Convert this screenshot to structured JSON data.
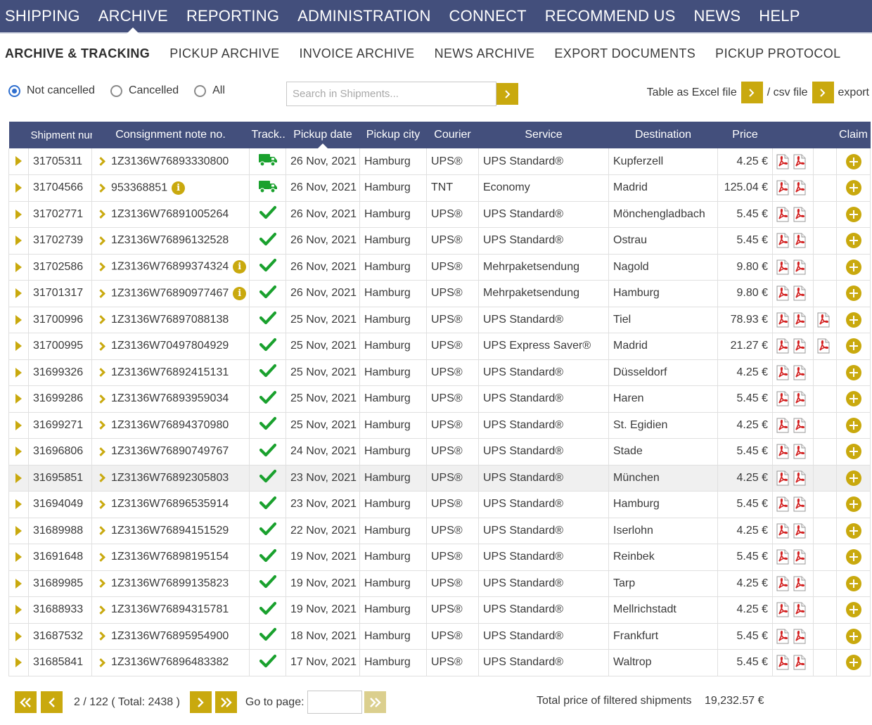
{
  "topnav": [
    {
      "label": "SHIPPING",
      "active": false
    },
    {
      "label": "ARCHIVE",
      "active": true
    },
    {
      "label": "REPORTING",
      "active": false
    },
    {
      "label": "ADMINISTRATION",
      "active": false
    },
    {
      "label": "CONNECT",
      "active": false
    },
    {
      "label": "RECOMMEND US",
      "active": false
    },
    {
      "label": "NEWS",
      "active": false
    },
    {
      "label": "HELP",
      "active": false
    }
  ],
  "subnav": [
    {
      "label": "ARCHIVE & TRACKING",
      "active": true
    },
    {
      "label": "PICKUP ARCHIVE",
      "active": false
    },
    {
      "label": "INVOICE ARCHIVE",
      "active": false
    },
    {
      "label": "NEWS ARCHIVE",
      "active": false
    },
    {
      "label": "EXPORT DOCUMENTS",
      "active": false
    },
    {
      "label": "PICKUP PROTOCOL",
      "active": false
    }
  ],
  "filters": {
    "options": [
      {
        "label": "Not cancelled",
        "checked": true
      },
      {
        "label": "Cancelled",
        "checked": false
      },
      {
        "label": "All",
        "checked": false
      }
    ],
    "search_placeholder": "Search in Shipments...",
    "search_value": "",
    "excel_label": "Table as Excel file",
    "csv_label": "/ csv file",
    "export_label": "export"
  },
  "table": {
    "headers": {
      "shipment_number": "Shipment number",
      "consignment": "Consignment note no.",
      "tracking": "Track..",
      "pickup_date": "Pickup date",
      "pickup_city": "Pickup city",
      "courier": "Courier",
      "service": "Service",
      "destination": "Destination",
      "price": "Price",
      "claim": "Claim"
    },
    "sorted_column": "pickup_date",
    "hover_row_index": 12,
    "rows": [
      {
        "id": "31705311",
        "consignment": "1Z3136W76893330800",
        "info": false,
        "status": "in-transit",
        "date": "26 Nov, 2021",
        "city": "Hamburg",
        "courier": "UPS®",
        "service": "UPS Standard®",
        "destination": "Kupferzell",
        "price": "4.25 €",
        "docs": 2,
        "extra_doc": false
      },
      {
        "id": "31704566",
        "consignment": "953368851",
        "info": true,
        "status": "in-transit",
        "date": "26 Nov, 2021",
        "city": "Hamburg",
        "courier": "TNT",
        "service": "Economy",
        "destination": "Madrid",
        "price": "125.04 €",
        "docs": 2,
        "extra_doc": false
      },
      {
        "id": "31702771",
        "consignment": "1Z3136W76891005264",
        "info": false,
        "status": "delivered",
        "date": "26 Nov, 2021",
        "city": "Hamburg",
        "courier": "UPS®",
        "service": "UPS Standard®",
        "destination": "Mönchengladbach",
        "price": "5.45 €",
        "docs": 2,
        "extra_doc": false
      },
      {
        "id": "31702739",
        "consignment": "1Z3136W76896132528",
        "info": false,
        "status": "delivered",
        "date": "26 Nov, 2021",
        "city": "Hamburg",
        "courier": "UPS®",
        "service": "UPS Standard®",
        "destination": "Ostrau",
        "price": "5.45 €",
        "docs": 2,
        "extra_doc": false
      },
      {
        "id": "31702586",
        "consignment": "1Z3136W76899374324",
        "info": true,
        "status": "delivered",
        "date": "26 Nov, 2021",
        "city": "Hamburg",
        "courier": "UPS®",
        "service": "Mehrpaketsendung",
        "destination": "Nagold",
        "price": "9.80 €",
        "docs": 2,
        "extra_doc": false
      },
      {
        "id": "31701317",
        "consignment": "1Z3136W76890977467",
        "info": true,
        "status": "delivered",
        "date": "26 Nov, 2021",
        "city": "Hamburg",
        "courier": "UPS®",
        "service": "Mehrpaketsendung",
        "destination": "Hamburg",
        "price": "9.80 €",
        "docs": 2,
        "extra_doc": false
      },
      {
        "id": "31700996",
        "consignment": "1Z3136W76897088138",
        "info": false,
        "status": "delivered",
        "date": "25 Nov, 2021",
        "city": "Hamburg",
        "courier": "UPS®",
        "service": "UPS Standard®",
        "destination": "Tiel",
        "price": "78.93 €",
        "docs": 2,
        "extra_doc": true
      },
      {
        "id": "31700995",
        "consignment": "1Z3136W70497804929",
        "info": false,
        "status": "delivered",
        "date": "25 Nov, 2021",
        "city": "Hamburg",
        "courier": "UPS®",
        "service": "UPS Express Saver®",
        "destination": "Madrid",
        "price": "21.27 €",
        "docs": 2,
        "extra_doc": true
      },
      {
        "id": "31699326",
        "consignment": "1Z3136W76892415131",
        "info": false,
        "status": "delivered",
        "date": "25 Nov, 2021",
        "city": "Hamburg",
        "courier": "UPS®",
        "service": "UPS Standard®",
        "destination": "Düsseldorf",
        "price": "4.25 €",
        "docs": 2,
        "extra_doc": false
      },
      {
        "id": "31699286",
        "consignment": "1Z3136W76893959034",
        "info": false,
        "status": "delivered",
        "date": "25 Nov, 2021",
        "city": "Hamburg",
        "courier": "UPS®",
        "service": "UPS Standard®",
        "destination": "Haren",
        "price": "5.45 €",
        "docs": 2,
        "extra_doc": false
      },
      {
        "id": "31699271",
        "consignment": "1Z3136W76894370980",
        "info": false,
        "status": "delivered",
        "date": "25 Nov, 2021",
        "city": "Hamburg",
        "courier": "UPS®",
        "service": "UPS Standard®",
        "destination": "St. Egidien",
        "price": "4.25 €",
        "docs": 2,
        "extra_doc": false
      },
      {
        "id": "31696806",
        "consignment": "1Z3136W76890749767",
        "info": false,
        "status": "delivered",
        "date": "24 Nov, 2021",
        "city": "Hamburg",
        "courier": "UPS®",
        "service": "UPS Standard®",
        "destination": "Stade",
        "price": "5.45 €",
        "docs": 2,
        "extra_doc": false
      },
      {
        "id": "31695851",
        "consignment": "1Z3136W76892305803",
        "info": false,
        "status": "delivered",
        "date": "23 Nov, 2021",
        "city": "Hamburg",
        "courier": "UPS®",
        "service": "UPS Standard®",
        "destination": "München",
        "price": "4.25 €",
        "docs": 2,
        "extra_doc": false
      },
      {
        "id": "31694049",
        "consignment": "1Z3136W76896535914",
        "info": false,
        "status": "delivered",
        "date": "23 Nov, 2021",
        "city": "Hamburg",
        "courier": "UPS®",
        "service": "UPS Standard®",
        "destination": "Hamburg",
        "price": "5.45 €",
        "docs": 2,
        "extra_doc": false
      },
      {
        "id": "31689988",
        "consignment": "1Z3136W76894151529",
        "info": false,
        "status": "delivered",
        "date": "22 Nov, 2021",
        "city": "Hamburg",
        "courier": "UPS®",
        "service": "UPS Standard®",
        "destination": "Iserlohn",
        "price": "4.25 €",
        "docs": 2,
        "extra_doc": false
      },
      {
        "id": "31691648",
        "consignment": "1Z3136W76898195154",
        "info": false,
        "status": "delivered",
        "date": "19 Nov, 2021",
        "city": "Hamburg",
        "courier": "UPS®",
        "service": "UPS Standard®",
        "destination": "Reinbek",
        "price": "5.45 €",
        "docs": 2,
        "extra_doc": false
      },
      {
        "id": "31689985",
        "consignment": "1Z3136W76899135823",
        "info": false,
        "status": "delivered",
        "date": "19 Nov, 2021",
        "city": "Hamburg",
        "courier": "UPS®",
        "service": "UPS Standard®",
        "destination": "Tarp",
        "price": "4.25 €",
        "docs": 2,
        "extra_doc": false
      },
      {
        "id": "31688933",
        "consignment": "1Z3136W76894315781",
        "info": false,
        "status": "delivered",
        "date": "19 Nov, 2021",
        "city": "Hamburg",
        "courier": "UPS®",
        "service": "UPS Standard®",
        "destination": "Mellrichstadt",
        "price": "4.25 €",
        "docs": 2,
        "extra_doc": false
      },
      {
        "id": "31687532",
        "consignment": "1Z3136W76895954900",
        "info": false,
        "status": "delivered",
        "date": "18 Nov, 2021",
        "city": "Hamburg",
        "courier": "UPS®",
        "service": "UPS Standard®",
        "destination": "Frankfurt",
        "price": "5.45 €",
        "docs": 2,
        "extra_doc": false
      },
      {
        "id": "31685841",
        "consignment": "1Z3136W76896483382",
        "info": false,
        "status": "delivered",
        "date": "17 Nov, 2021",
        "city": "Hamburg",
        "courier": "UPS®",
        "service": "UPS Standard®",
        "destination": "Waltrop",
        "price": "5.45 €",
        "docs": 2,
        "extra_doc": false
      }
    ]
  },
  "pager": {
    "page_info": "2 / 122 ( Total: 2438 )",
    "goto_label": "Go to page:",
    "goto_value": ""
  },
  "total": {
    "label": "Total price of filtered shipments",
    "value": "19,232.57 €"
  },
  "colors": {
    "nav_bg": "#434f7c",
    "accent_gold": "#c9a90e",
    "check_green": "#1aa12e",
    "pdf_red": "#d32020",
    "radio_blue": "#2f6fcf"
  },
  "icons": {
    "expand": "expand-triangle-icon",
    "chevron": "chevron-right-icon",
    "info": "info-icon",
    "truck": "truck-icon",
    "check": "checkmark-icon",
    "pdf": "pdf-icon",
    "claim": "plus-circle-icon",
    "first": "double-chevron-left-icon",
    "prev": "chevron-left-icon",
    "next": "chevron-right-icon",
    "last": "double-chevron-right-icon"
  }
}
